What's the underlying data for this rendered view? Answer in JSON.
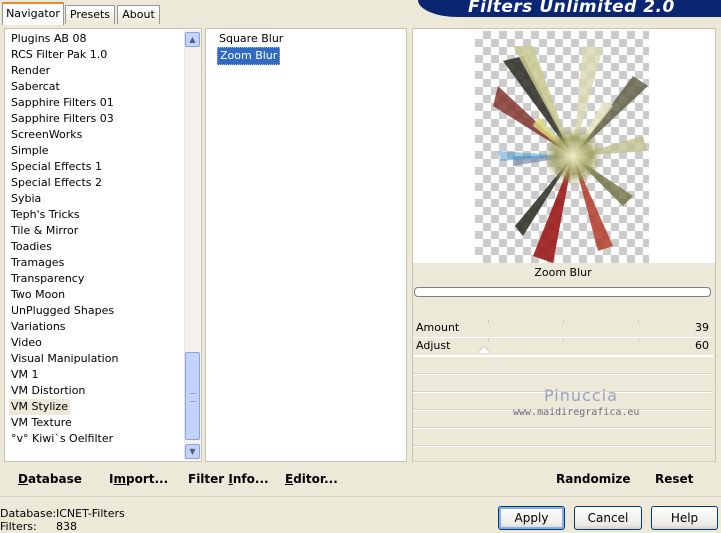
{
  "header": {
    "banner_title": "Filters Unlimited 2.0"
  },
  "tabs": [
    {
      "label": "Navigator",
      "active": true
    },
    {
      "label": "Presets",
      "active": false
    },
    {
      "label": "About",
      "active": false
    }
  ],
  "categories": {
    "items": [
      "Plugins AB 08",
      "RCS Filter Pak 1.0",
      "Render",
      "Sabercat",
      "Sapphire Filters 01",
      "Sapphire Filters 03",
      "ScreenWorks",
      "Simple",
      "Special Effects 1",
      "Special Effects 2",
      "Sybia",
      "Teph's Tricks",
      "Tile & Mirror",
      "Toadies",
      "Tramages",
      "Transparency",
      "Two Moon",
      "UnPlugged Shapes",
      "Variations",
      "Video",
      "Visual Manipulation",
      "VM 1",
      "VM Distortion",
      "VM Stylize",
      "VM Texture",
      "°v° Kiwi`s Oelfilter"
    ],
    "selected": "VM Stylize",
    "scroll_position_fraction": 0.75
  },
  "filters": {
    "items": [
      "Square Blur",
      "Zoom Blur"
    ],
    "selected": "Zoom Blur"
  },
  "preview": {
    "filter_name": "Zoom Blur",
    "parameters": [
      {
        "label": "Amount",
        "value": "39"
      },
      {
        "label": "Adjust",
        "value": "60"
      }
    ],
    "watermark_name": "Pinuccia",
    "watermark_url": "www.maidiregrafica.eu"
  },
  "left_buttons": {
    "database": "Database",
    "import": "Import...",
    "filter_info": "Filter Info...",
    "editor": "Editor..."
  },
  "right_buttons": {
    "randomize": "Randomize",
    "reset": "Reset"
  },
  "status": {
    "database_label": "Database:",
    "database_value": "ICNET-Filters",
    "filters_label": "Filters:",
    "filters_value": "838"
  },
  "dialog_buttons": {
    "apply": "Apply",
    "cancel": "Cancel",
    "help": "Help"
  },
  "colors": {
    "window_bg": "#ece9d8",
    "banner_bg": "#0a2672",
    "selection_bg": "#316ac5",
    "tab_accent": "#e68b2c"
  }
}
